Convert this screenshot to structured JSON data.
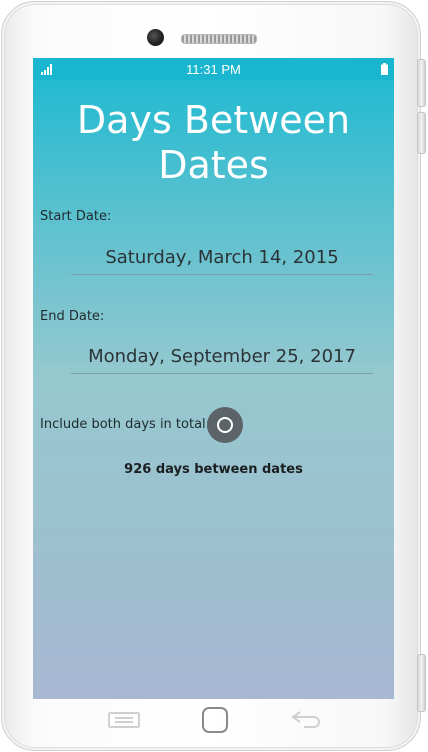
{
  "status_bar": {
    "time": "11:31 PM",
    "signal_icon": "signal-icon",
    "battery_icon": "battery-icon"
  },
  "app": {
    "title_line1": "Days Between",
    "title_line2": "Dates",
    "start_label": "Start Date:",
    "start_value": "Saturday, March 14, 2015",
    "end_label": "End Date:",
    "end_value": "Monday, September 25, 2017",
    "include_label": "Include both days in total:",
    "include_both_days": false,
    "result": "926 days between dates"
  },
  "nav_bar": {
    "menu_icon": "menu-icon",
    "home_icon": "home-icon",
    "back_icon": "back-icon"
  },
  "colors": {
    "status_bar": "#1ab6cf",
    "gradient_top": "#1ab9d1",
    "gradient_bottom": "#a8b8d3",
    "toggle": "#5c6468"
  }
}
